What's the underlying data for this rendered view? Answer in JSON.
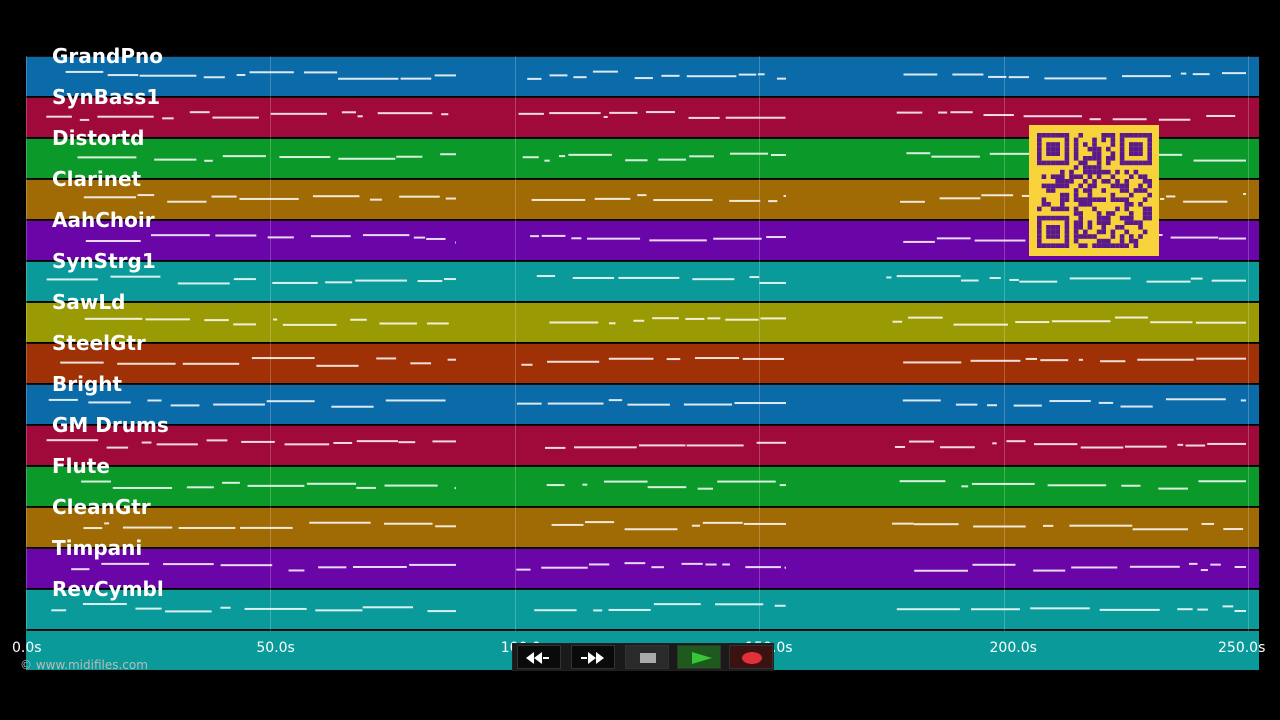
{
  "tracks": [
    {
      "name": "GrandPno",
      "color": "#0b6aa8"
    },
    {
      "name": "SynBass1",
      "color": "#a00a3a"
    },
    {
      "name": "Distortd",
      "color": "#0b9a2a"
    },
    {
      "name": "Clarinet",
      "color": "#a06a05"
    },
    {
      "name": "AahChoir",
      "color": "#6a05a8"
    },
    {
      "name": "SynStrg1",
      "color": "#0a9a9a"
    },
    {
      "name": "SawLd",
      "color": "#9a9a05"
    },
    {
      "name": "SteelGtr",
      "color": "#a03005"
    },
    {
      "name": "Bright",
      "color": "#0b6aa8"
    },
    {
      "name": "GM Drums",
      "color": "#a00a3a"
    },
    {
      "name": "Flute",
      "color": "#0b9a2a"
    },
    {
      "name": "CleanGtr",
      "color": "#a06a05"
    },
    {
      "name": "Timpani",
      "color": "#6a05a8"
    },
    {
      "name": "RevCymbl",
      "color": "#0a9a9a"
    },
    {
      "name": "",
      "color": "#0a9a9a"
    }
  ],
  "timeline": {
    "ticks": [
      "0.0s",
      "50.0s",
      "100.0s",
      "150.0s",
      "200.0s",
      "250.0s"
    ],
    "max_seconds": 250
  },
  "copyright": "© www.midifiles.com",
  "transport": {
    "buttons": [
      {
        "name": "rewind-button",
        "glyph": "◀◀"
      },
      {
        "name": "fast-forward-button",
        "glyph": "▶▶"
      },
      {
        "name": "stop-button",
        "glyph": ""
      },
      {
        "name": "play-button",
        "glyph": ""
      },
      {
        "name": "record-button",
        "glyph": ""
      }
    ]
  },
  "qr_code": {
    "color": "#f7d23a",
    "ink": "#5a1a8a"
  }
}
